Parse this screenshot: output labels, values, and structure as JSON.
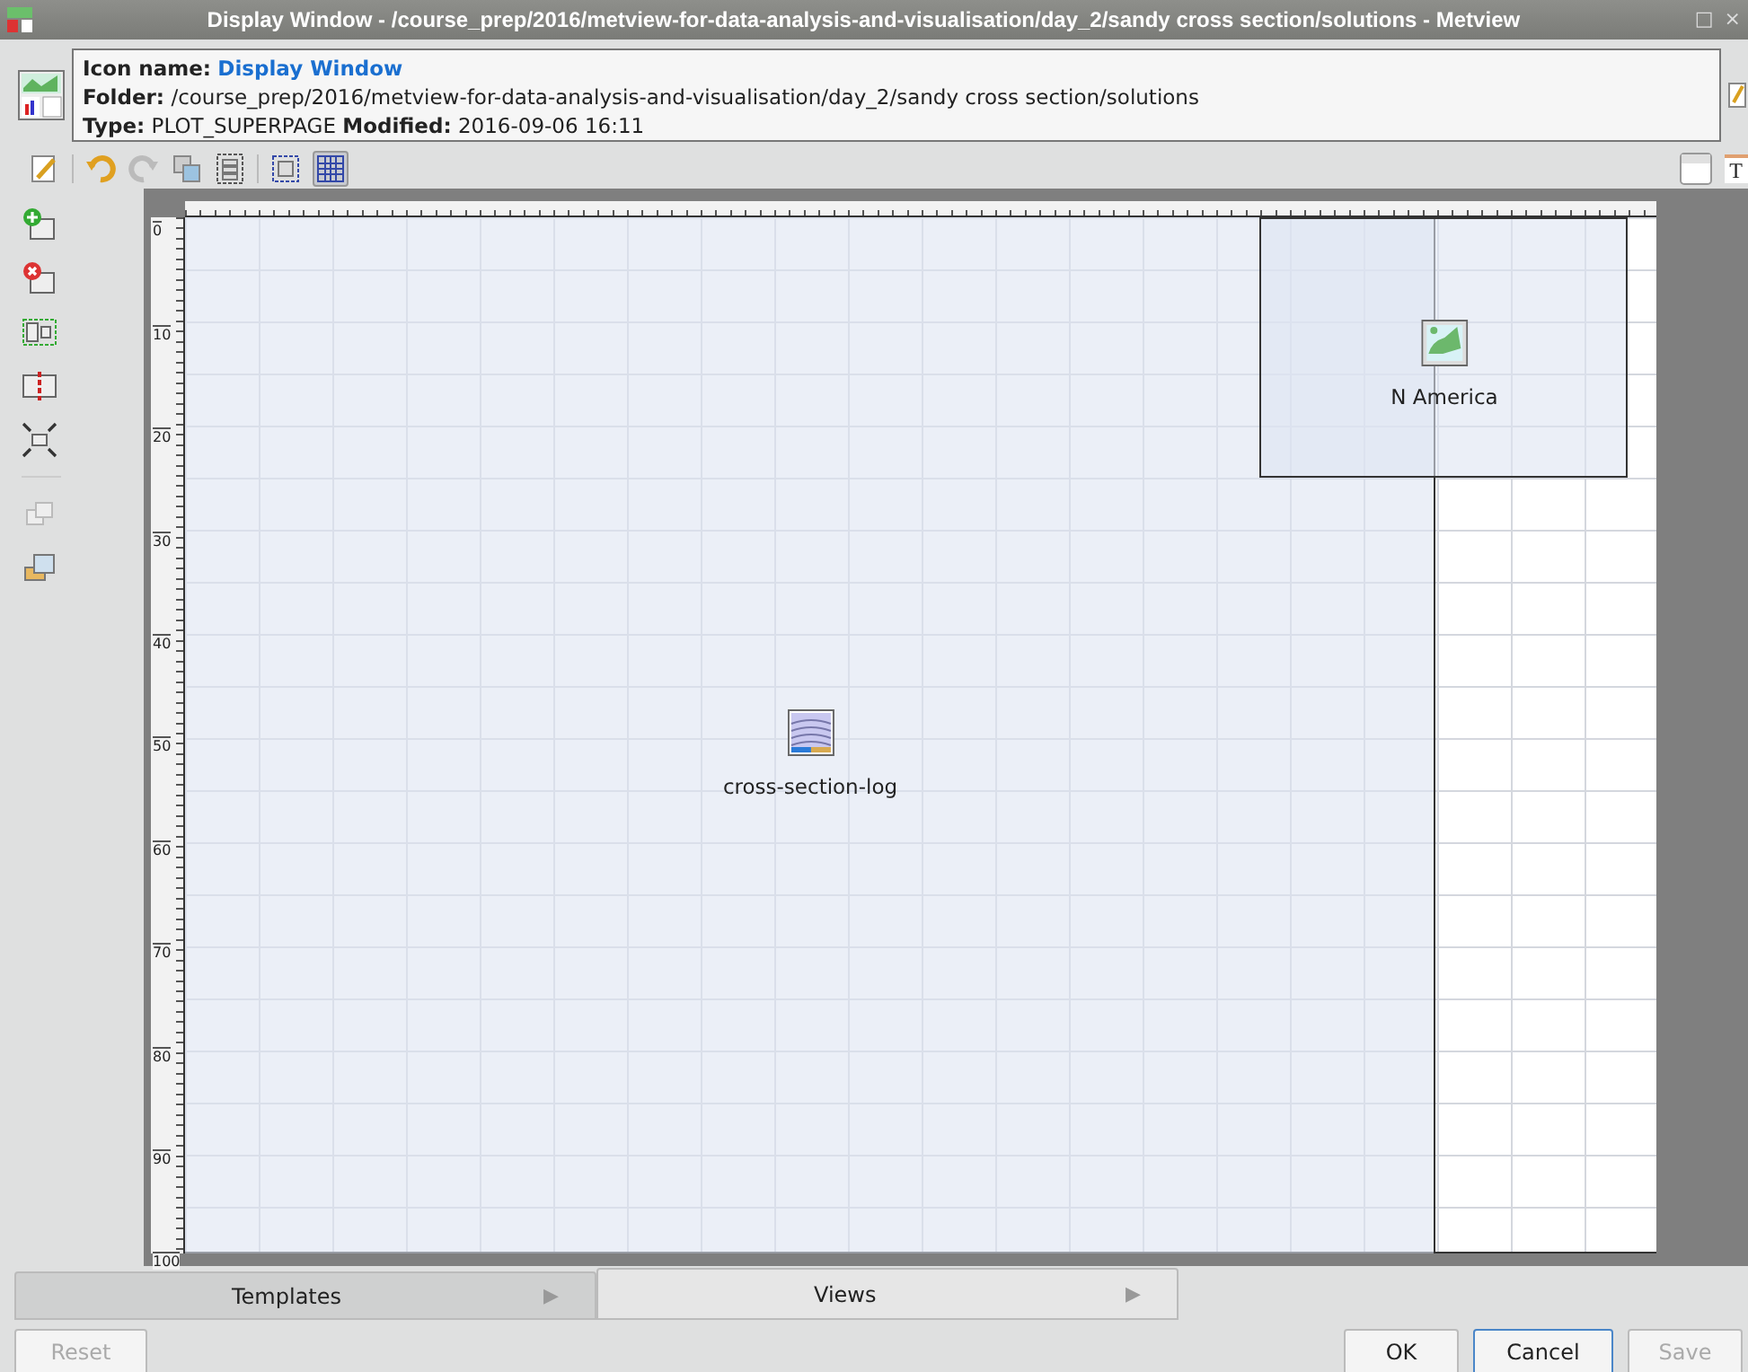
{
  "window": {
    "title": "Display Window - /course_prep/2016/metview-for-data-analysis-and-visualisation/day_2/sandy cross section/solutions - Metview",
    "controls": [
      "□",
      "×"
    ]
  },
  "info_lines": [
    {
      "kind": "name",
      "label": "Icon name:",
      "value": "Display Window"
    },
    {
      "kind": "plain",
      "label": "Folder:",
      "value": "/course_prep/2016/metview-for-data-analysis-and-visualisation/day_2/sandy cross section/solutions"
    },
    {
      "kind": "plain",
      "label": "Type:",
      "value": "PLOT_SUPERPAGE **Modified:** 2016-09-06 16:11"
    }
  ],
  "toolbar": {
    "grid_toggle": {
      "on": true
    },
    "text_tool": "T"
  },
  "ruler_labels": [
    "0",
    "10",
    "20",
    "30",
    "40",
    "50",
    "60",
    "70",
    "80",
    "90",
    "100"
  ],
  "views": [
    {
      "kind": "cross-section",
      "label": "cross-section-log"
    },
    {
      "kind": "map",
      "label": "N America"
    }
  ],
  "tabs": [
    {
      "label": "Templates",
      "arrow": "▶",
      "selected": false
    },
    {
      "label": "Views",
      "arrow": "▶",
      "selected": true
    }
  ],
  "buttons": [
    {
      "label": "Reset",
      "disabled": true,
      "focused": false
    },
    {
      "label": "OK",
      "disabled": false,
      "focused": false
    },
    {
      "label": "Cancel",
      "disabled": false,
      "focused": true
    },
    {
      "label": "Save",
      "disabled": true,
      "focused": false
    }
  ]
}
